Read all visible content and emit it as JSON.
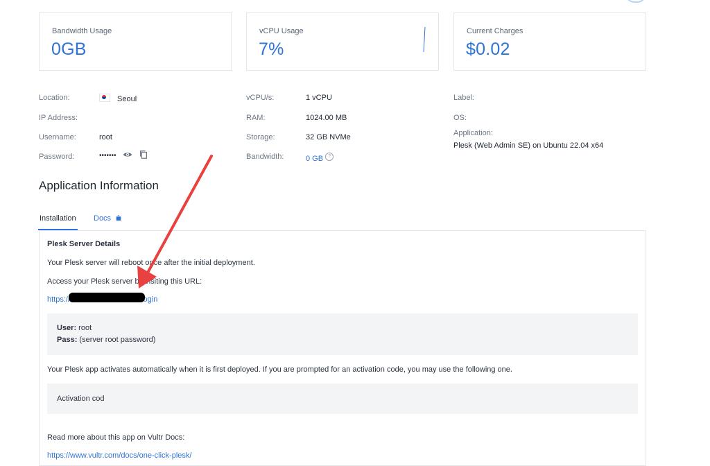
{
  "stats": [
    {
      "label": "Bandwidth Usage",
      "value": "0GB"
    },
    {
      "label": "vCPU Usage",
      "value": "7%"
    },
    {
      "label": "Current Charges",
      "value": "$0.02"
    }
  ],
  "details_left": {
    "location_label": "Location:",
    "location_value": "Seoul",
    "ip_label": "IP Address:",
    "username_label": "Username:",
    "username_value": "root",
    "password_label": "Password:",
    "password_value": "•••••••"
  },
  "details_mid": {
    "vcpu_label": "vCPU/s:",
    "vcpu_value": "1 vCPU",
    "ram_label": "RAM:",
    "ram_value": "1024.00 MB",
    "storage_label": "Storage:",
    "storage_value": "32 GB NVMe",
    "bandwidth_label": "Bandwidth:",
    "bandwidth_value": "0 GB",
    "help_glyph": "?"
  },
  "details_right": {
    "label_label": "Label:",
    "os_label": "OS:",
    "application_label": "Application:",
    "application_value": "Plesk (Web Admin SE) on Ubuntu 22.04 x64"
  },
  "section": {
    "title": "Application Information",
    "tabs": [
      {
        "label": "Installation",
        "active": true
      },
      {
        "label": "Docs",
        "active": false
      }
    ]
  },
  "panel": {
    "heading": "Plesk Server Details",
    "reboot_text": "Your Plesk server will reboot once after the initial deployment.",
    "access_text": "Access your Plesk server by visiting this URL:",
    "url_prefix": "https://",
    "url_suffix": "/login",
    "user_label": "User:",
    "user_value": " root",
    "pass_label": "Pass:",
    "pass_value": " (server root password)",
    "activation_info": "Your Plesk app activates automatically when it is first deployed. If you are prompted for an activation code, you may use the following one.",
    "activation_label": "Activation cod",
    "read_more": "Read more about this app on Vultr Docs:",
    "docs_link": "https://www.vultr.com/docs/one-click-plesk/"
  },
  "colors": {
    "accent": "#2f73d6",
    "annotation_arrow": "#e8413f",
    "border": "#e3e6ea"
  },
  "icons": [
    "eye-icon",
    "copy-icon",
    "help-circle-icon",
    "external-link-icon",
    "korea-flag-icon",
    "annotation-arrow"
  ]
}
